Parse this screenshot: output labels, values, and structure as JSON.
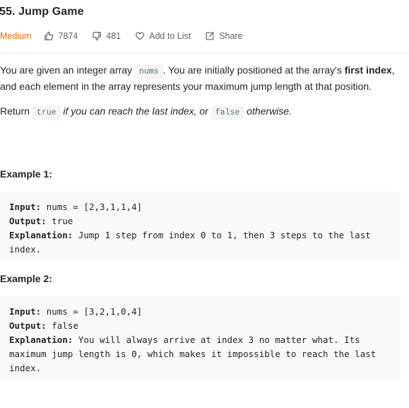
{
  "problem": {
    "title": "55. Jump Game",
    "difficulty": "Medium",
    "likes": "7874",
    "dislikes": "481",
    "add_to_list": "Add to List",
    "share": "Share"
  },
  "description": {
    "p1_a": "You are given an integer array ",
    "p1_code": "nums",
    "p1_b": ". You are initially positioned at the array's ",
    "p1_bold": "first index",
    "p1_c": ", and each element in the array represents your maximum jump length at that position.",
    "p2_a": "Return ",
    "p2_code1": "true",
    "p2_italic": " if you can reach the last index, or ",
    "p2_code2": "false",
    "p2_b": " otherwise."
  },
  "examples": [
    {
      "title": "Example 1:",
      "input_label": "Input:",
      "input": " nums = [2,3,1,1,4]",
      "output_label": "Output:",
      "output": " true",
      "explanation_label": "Explanation:",
      "explanation": " Jump 1 step from index 0 to 1, then 3 steps to the last index."
    },
    {
      "title": "Example 2:",
      "input_label": "Input:",
      "input": " nums = [3,2,1,0,4]",
      "output_label": "Output:",
      "output": " false",
      "explanation_label": "Explanation:",
      "explanation": " You will always arrive at index 3 no matter what. Its maximum jump length is 0, which makes it impossible to reach the last index."
    }
  ]
}
